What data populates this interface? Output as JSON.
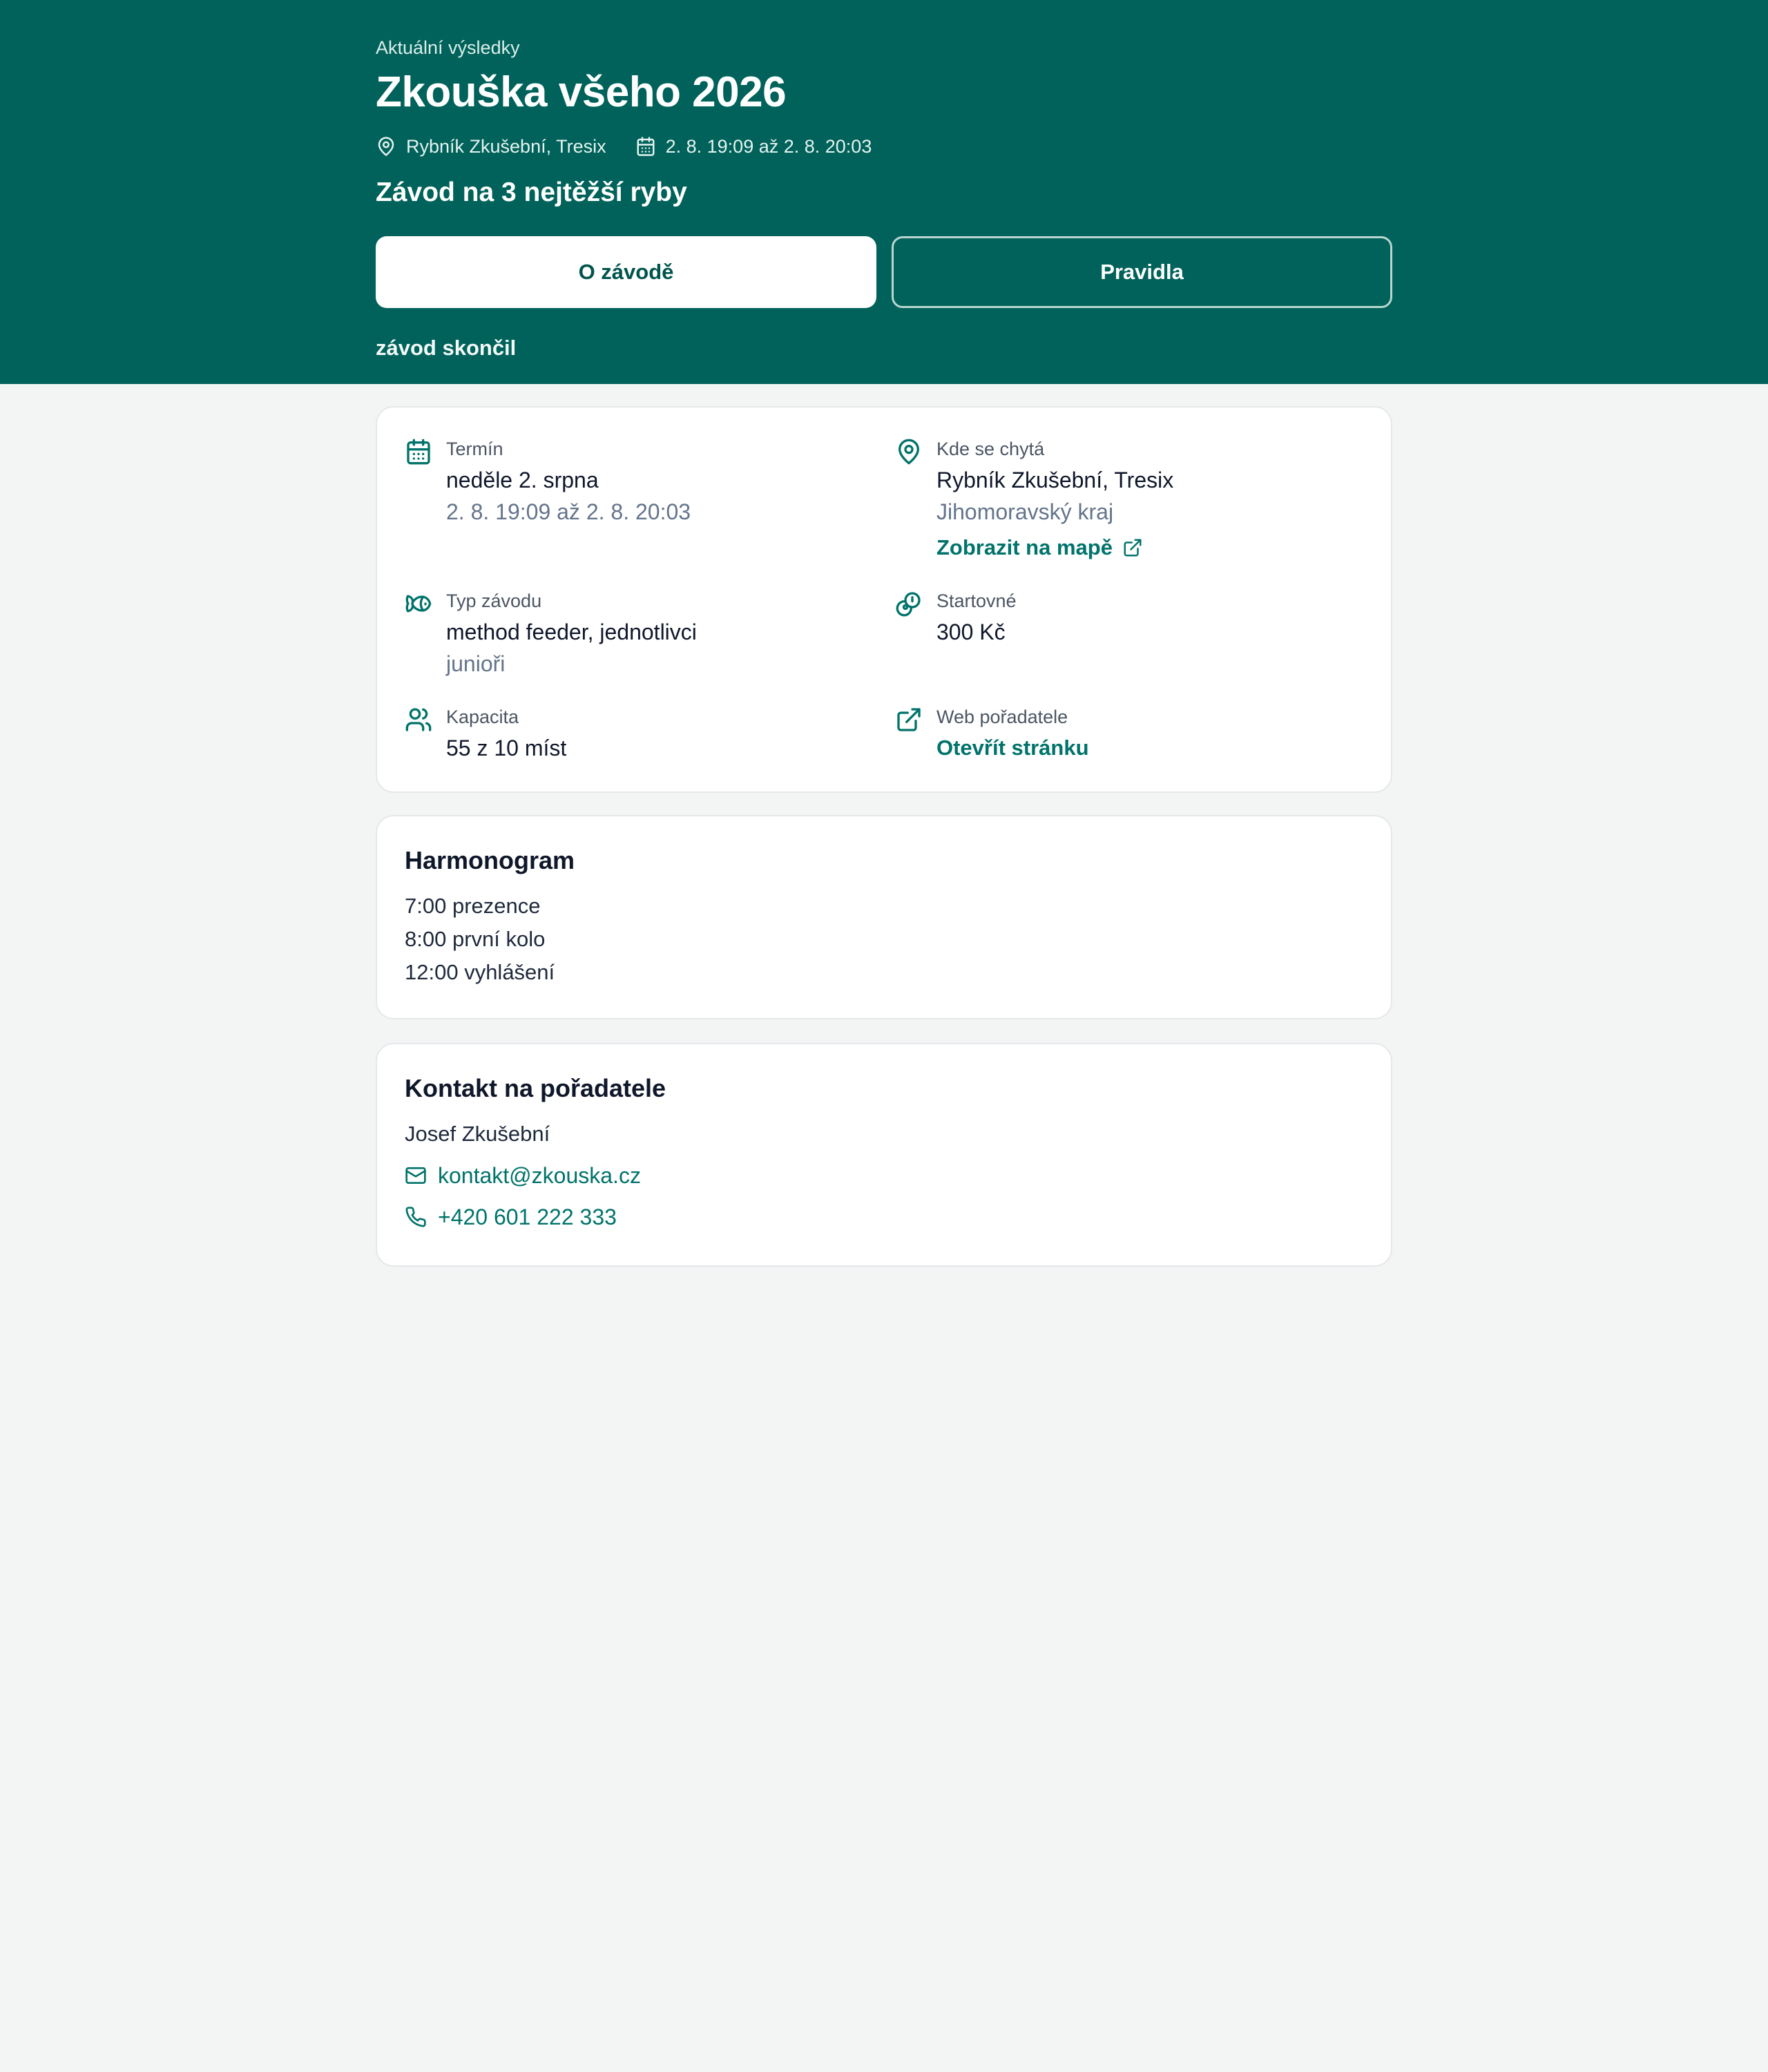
{
  "hero": {
    "crumb": "Aktuální výsledky",
    "title": "Zkouška všeho 2026",
    "location": "Rybník Zkušební, Tresix",
    "dates": "2. 8. 19:09 až 2. 8. 20:03",
    "subtitle": "Závod na 3 nejtěžší ryby",
    "btn_about": "O závodě",
    "btn_rules": "Pravidla",
    "status": "závod skončil"
  },
  "info": {
    "term": {
      "label": "Termín",
      "value": "neděle 2. srpna",
      "sub": "2. 8. 19:09 až 2. 8. 20:03",
      "icon": "calendar-icon"
    },
    "place": {
      "label": "Kde se chytá",
      "value": "Rybník Zkušební, Tresix",
      "sub": "Jihomoravský kraj",
      "link": "Zobrazit na mapě",
      "icon": "map-pin-icon"
    },
    "type": {
      "label": "Typ závodu",
      "value": "method feeder, jednotlivci",
      "sub": "junioři",
      "icon": "fish-icon"
    },
    "fee": {
      "label": "Startovné",
      "value": "300 Kč",
      "icon": "coins-icon"
    },
    "capacity": {
      "label": "Kapacita",
      "value": "55 z 10 míst",
      "icon": "users-icon"
    },
    "web": {
      "label": "Web pořadatele",
      "link": "Otevřít stránku",
      "icon": "external-link-icon"
    }
  },
  "schedule": {
    "title": "Harmonogram",
    "items": [
      "7:00 prezence",
      "8:00 první kolo",
      "12:00 vyhlášení"
    ]
  },
  "contact": {
    "title": "Kontakt na pořadatele",
    "name": "Josef Zkušební",
    "email": "kontakt@zkouska.cz",
    "phone": "+420 601 222 333"
  },
  "colors": {
    "brand": "#00625a",
    "accent": "#00736a",
    "background": "#f3f4f4"
  }
}
